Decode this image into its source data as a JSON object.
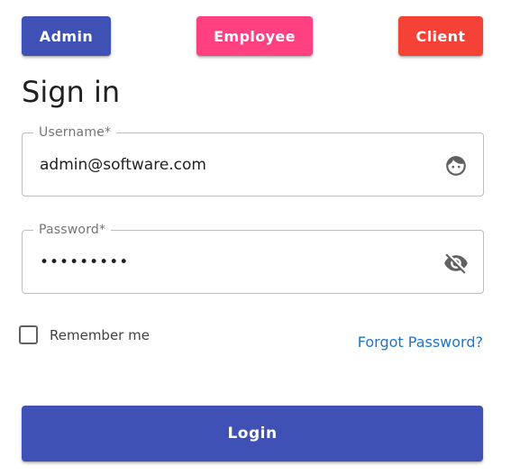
{
  "roles": {
    "admin_label": "Admin",
    "employee_label": "Employee",
    "client_label": "Client",
    "admin_color": "#3f51b5",
    "employee_color": "#ff4081",
    "client_color": "#f44336"
  },
  "page": {
    "title": "Sign in"
  },
  "form": {
    "username": {
      "label": "Username*",
      "value": "admin@software.com",
      "icon": "face-icon"
    },
    "password": {
      "label": "Password*",
      "value": "•••••••••",
      "icon": "visibility-off-icon"
    },
    "remember_label": "Remember me",
    "remember_checked": false,
    "forgot_label": "Forgot Password?",
    "login_label": "Login",
    "login_color": "#3f51b5",
    "link_color": "#1976d2"
  }
}
